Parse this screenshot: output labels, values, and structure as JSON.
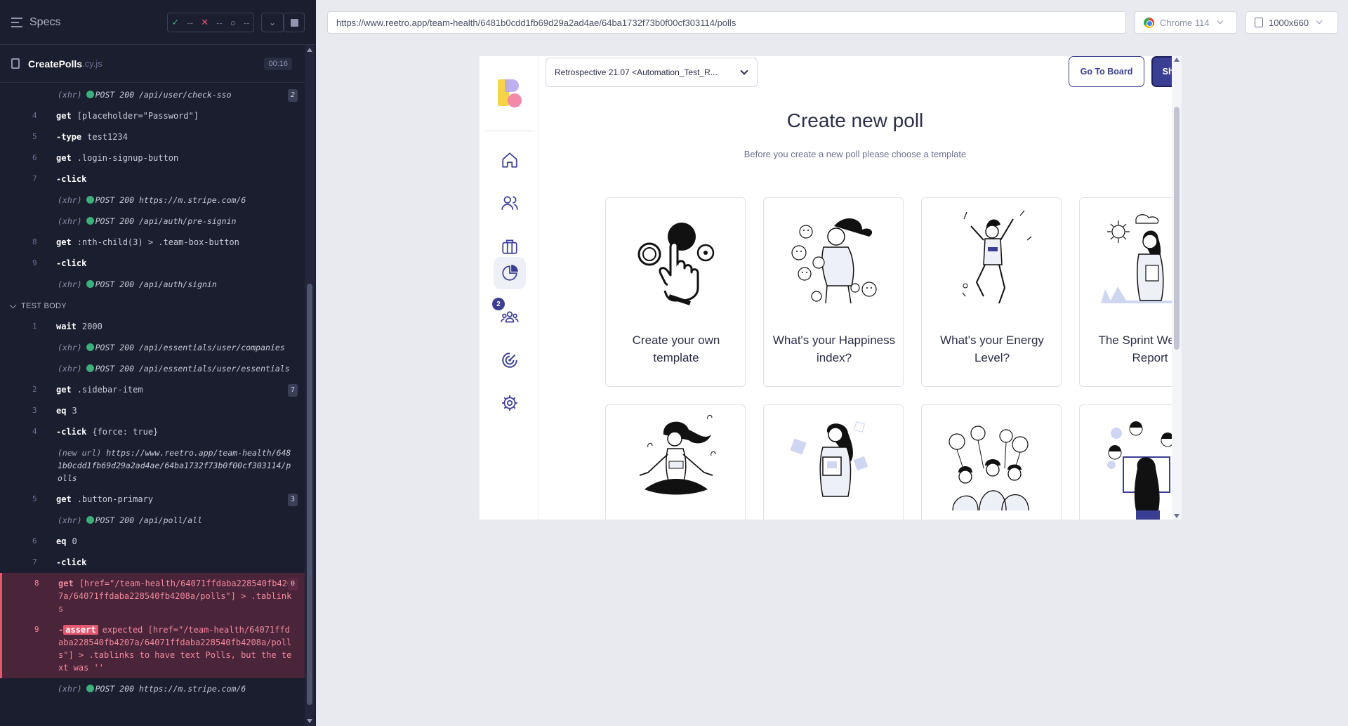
{
  "reporter": {
    "specs_label": "Specs",
    "stats": {
      "passed": "--",
      "failed": "--",
      "pending": "--"
    },
    "spec_name": "CreatePolls",
    "spec_ext": ".cy.js",
    "duration": "00:16",
    "logs": [
      {
        "kind": "xhr",
        "method": "POST",
        "status": "200",
        "text": "/api/user/check-sso",
        "badge": "2"
      },
      {
        "kind": "cmd",
        "num": "4",
        "name": "get",
        "msg": "[placeholder=\"Password\"]"
      },
      {
        "kind": "cmd",
        "num": "5",
        "name": "-type",
        "msg": "test1234"
      },
      {
        "kind": "cmd",
        "num": "6",
        "name": "get",
        "msg": ".login-signup-button"
      },
      {
        "kind": "cmd",
        "num": "7",
        "name": "-click",
        "msg": ""
      },
      {
        "kind": "xhr",
        "method": "POST",
        "status": "200",
        "text": "https://m.stripe.com/6"
      },
      {
        "kind": "xhr",
        "method": "POST",
        "status": "200",
        "text": "/api/auth/pre-signin"
      },
      {
        "kind": "cmd",
        "num": "8",
        "name": "get",
        "msg": ":nth-child(3) > .team-box-button"
      },
      {
        "kind": "cmd",
        "num": "9",
        "name": "-click",
        "msg": ""
      },
      {
        "kind": "xhr",
        "method": "POST",
        "status": "200",
        "text": "/api/auth/signin"
      },
      {
        "kind": "section",
        "text": "TEST BODY"
      },
      {
        "kind": "cmd",
        "num": "1",
        "name": "wait",
        "msg": "2000"
      },
      {
        "kind": "xhr",
        "method": "POST",
        "status": "200",
        "text": "/api/essentials/user/companies"
      },
      {
        "kind": "xhr",
        "method": "POST",
        "status": "200",
        "text": "/api/essentials/user/essentials"
      },
      {
        "kind": "cmd",
        "num": "2",
        "name": "get",
        "msg": ".sidebar-item",
        "badge": "7"
      },
      {
        "kind": "cmd",
        "num": "3",
        "name": "eq",
        "msg": "3"
      },
      {
        "kind": "cmd",
        "num": "4",
        "name": "-click",
        "msg": "{force: true}"
      },
      {
        "kind": "url",
        "label": "(new url)",
        "text": "https://www.reetro.app/team-health/6481b0cdd1fb69d29a2ad4ae/64ba1732f73b0f00cf303114/polls"
      },
      {
        "kind": "cmd",
        "num": "5",
        "name": "get",
        "msg": ".button-primary",
        "badge": "3"
      },
      {
        "kind": "xhr",
        "method": "POST",
        "status": "200",
        "text": "/api/poll/all"
      },
      {
        "kind": "cmd",
        "num": "6",
        "name": "eq",
        "msg": "0"
      },
      {
        "kind": "cmd",
        "num": "7",
        "name": "-click",
        "msg": ""
      },
      {
        "kind": "failed",
        "num": "8",
        "name": "get",
        "msg": "[href=\"/team-health/64071ffdaba228540fb4207a/64071ffdaba228540fb4208a/polls\"] > .tablinks",
        "badge": "0"
      },
      {
        "kind": "failed-assert",
        "num": "9",
        "name": "-assert",
        "msg": "expected [href=\"/team-health/64071ffdaba228540fb4207a/64071ffdaba228540fb4208a/polls\"] > .tablinks to have text Polls, but the text was ''"
      },
      {
        "kind": "xhr",
        "method": "POST",
        "status": "200",
        "text": "https://m.stripe.com/6"
      }
    ]
  },
  "aut": {
    "url": "https://www.reetro.app/team-health/6481b0cdd1fb69d29a2ad4ae/64ba1732f73b0f00cf303114/polls",
    "browser": "Chrome 114",
    "viewport": "1000x660"
  },
  "app": {
    "retro_select": "Retrospective 21.07 <Automation_Test_R...",
    "go_to_board": "Go To Board",
    "show_polls": "Show Polls",
    "title": "Create new poll",
    "subtitle": "Before you create a new poll please choose a template",
    "polls_badge": "2",
    "nav_icons": [
      "home-icon",
      "team-icon",
      "briefcase-icon",
      "polls-icon",
      "group-icon",
      "target-icon",
      "settings-icon"
    ],
    "cards": [
      {
        "label": "Create your own template",
        "art": "pointer-hand"
      },
      {
        "label": "What's your Happiness index?",
        "art": "happiness"
      },
      {
        "label": "What's your Energy Level?",
        "art": "energy"
      },
      {
        "label": "The Sprint Weather Report",
        "art": "weather"
      },
      {
        "label": "",
        "art": "meditation"
      },
      {
        "label": "",
        "art": "laptop-woman"
      },
      {
        "label": "",
        "art": "team-balloons"
      },
      {
        "label": "",
        "art": "screen-woman"
      }
    ]
  }
}
